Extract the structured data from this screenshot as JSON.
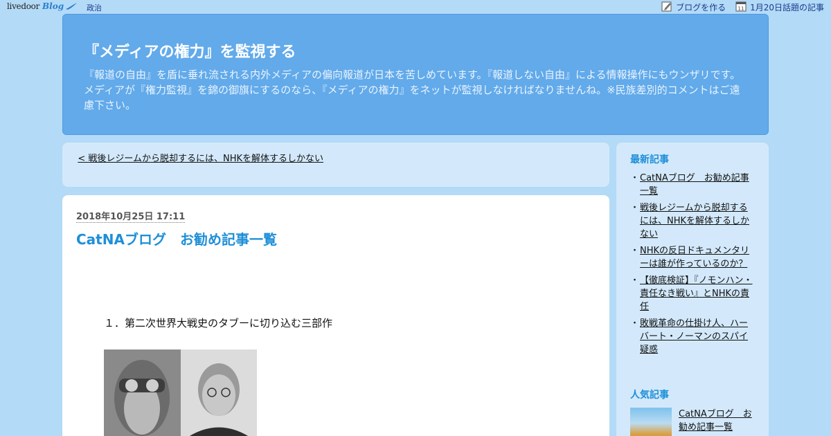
{
  "topbar": {
    "logo_brand": "livedoor",
    "logo_blog": "Blog",
    "category": "政治",
    "create_blog": "ブログを作る",
    "calendar_day": "11",
    "trending": "1月20日話題の記事"
  },
  "header": {
    "title": "『メディアの権力』を監視する",
    "description": "『報道の自由』を盾に垂れ流される内外メディアの偏向報道が日本を苦しめています。『報道しない自由』による情報操作にもウンザリです。メディアが『権力監視』を錦の御旗にするのなら、『メディアの権力』をネットが監視しなければなりませんね。※民族差別的コメントはご遠慮下さい。"
  },
  "prev_post": {
    "label": "< 戦後レジームから脱却するには、NHKを解体するしかない"
  },
  "article": {
    "date": "2018年10月25日 17:11",
    "title": "CatNAブログ　お勧め記事一覧",
    "section_heading": "１．第二次世界大戦史のタブーに切り込む三部作"
  },
  "sidebar": {
    "latest_heading": "最新記事",
    "bullet": "・",
    "latest_items": [
      "CatNAブログ　お勧め記事一覧",
      "戦後レジームから脱却するには、NHKを解体するしかない",
      "NHKの反日ドキュメンタリーは誰が作っているのか？",
      "【徹底検証】『ノモンハン・責任なき戦い』とNHKの責任",
      "敗戦革命の仕掛け人、ハーバート・ノーマンのスパイ疑惑"
    ],
    "popular_heading": "人気記事",
    "popular_items": [
      "CatNAブログ　お勧め記事一覧"
    ]
  },
  "colors": {
    "page_bg": "#b3daf7",
    "header_bg": "#62aaea",
    "panel_bg": "#d3e9fb",
    "accent": "#1e8fd8"
  }
}
